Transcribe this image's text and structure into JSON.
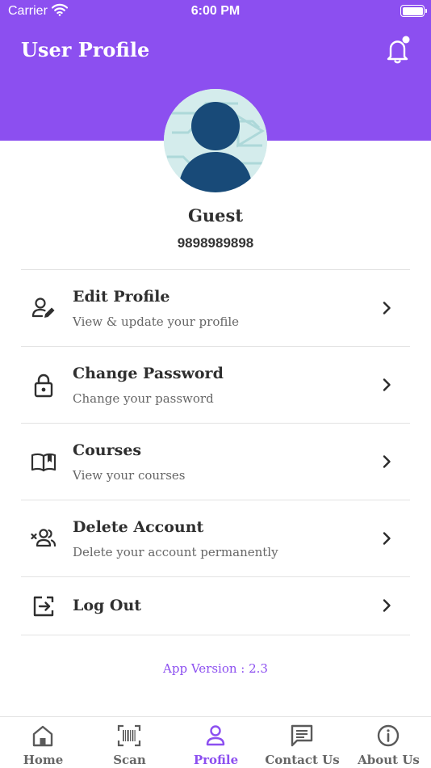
{
  "status_bar": {
    "carrier": "Carrier",
    "time": "6:00 PM"
  },
  "header": {
    "title": "User Profile",
    "bell_icon": "bell-icon",
    "has_notification_dot": true
  },
  "user": {
    "name": "Guest",
    "phone": "9898989898",
    "avatar_icon": "person-avatar"
  },
  "menu": [
    {
      "title": "Edit Profile",
      "subtitle": "View & update your profile",
      "icon": "edit-user-icon"
    },
    {
      "title": "Change Password",
      "subtitle": "Change your password",
      "icon": "lock-icon"
    },
    {
      "title": "Courses",
      "subtitle": "View your courses",
      "icon": "book-icon"
    },
    {
      "title": "Delete Account",
      "subtitle": "Delete your account permanently",
      "icon": "remove-users-icon"
    },
    {
      "title": "Log Out",
      "icon": "logout-icon"
    }
  ],
  "app_version": "App Version : 2.3",
  "tabs": [
    {
      "label": "Home",
      "icon": "home-icon",
      "active": false
    },
    {
      "label": "Scan",
      "icon": "barcode-icon",
      "active": false
    },
    {
      "label": "Profile",
      "icon": "profile-icon",
      "active": true
    },
    {
      "label": "Contact Us",
      "icon": "message-icon",
      "active": false
    },
    {
      "label": "About Us",
      "icon": "info-icon",
      "active": false
    }
  ],
  "colors": {
    "accent": "#8c4ff0",
    "avatar_dark": "#184a78",
    "text": "#2f2f2f",
    "muted": "#666666"
  }
}
